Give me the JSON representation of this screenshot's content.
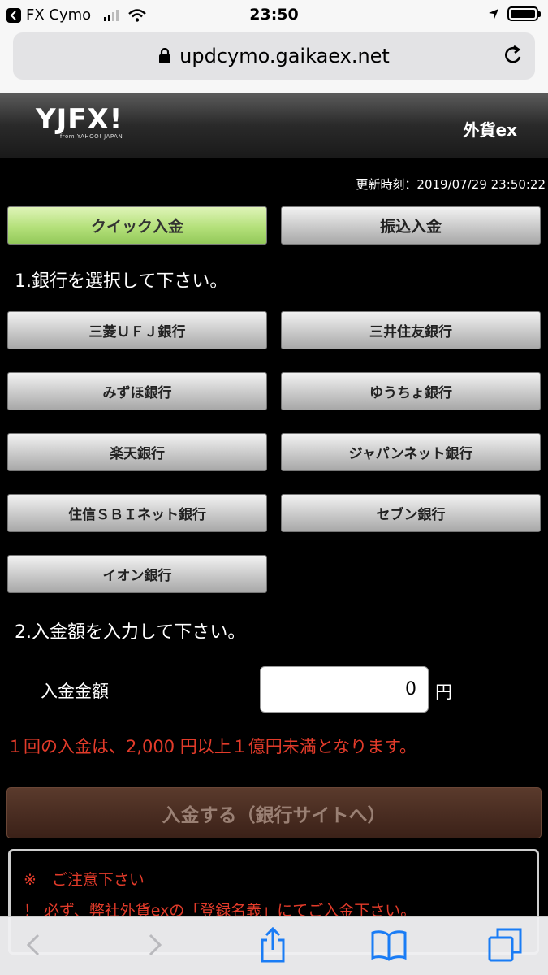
{
  "status_bar": {
    "back_app": "FX Cymo",
    "time": "23:50"
  },
  "browser": {
    "url": "updcymo.gaikaex.net"
  },
  "header": {
    "logo_text": "YJFX!",
    "logo_sub": "from YAHOO! JAPAN",
    "brand": "外貨ex"
  },
  "updated_time": "更新時刻：2019/07/29 23:50:22",
  "tabs": {
    "quick": "クイック入金",
    "transfer": "振込入金"
  },
  "step1": "1.銀行を選択して下さい。",
  "banks": [
    "三菱ＵＦＪ銀行",
    "三井住友銀行",
    "みずほ銀行",
    "ゆうちょ銀行",
    "楽天銀行",
    "ジャパンネット銀行",
    "住信ＳＢＩネット銀行",
    "セブン銀行",
    "イオン銀行"
  ],
  "step2": "2.入金額を入力して下さい。",
  "amount": {
    "label": "入金金額",
    "value": "0",
    "unit": "円"
  },
  "limit_notice": "１回の入金は、2,000 円以上１億円未満となります。",
  "submit_label": "入金する（銀行サイトへ）",
  "caution": {
    "title": "※　ご注意下さい",
    "line1": "！ 必ず、弊社外貨exの「登録名義」にてご入金下さい。"
  }
}
